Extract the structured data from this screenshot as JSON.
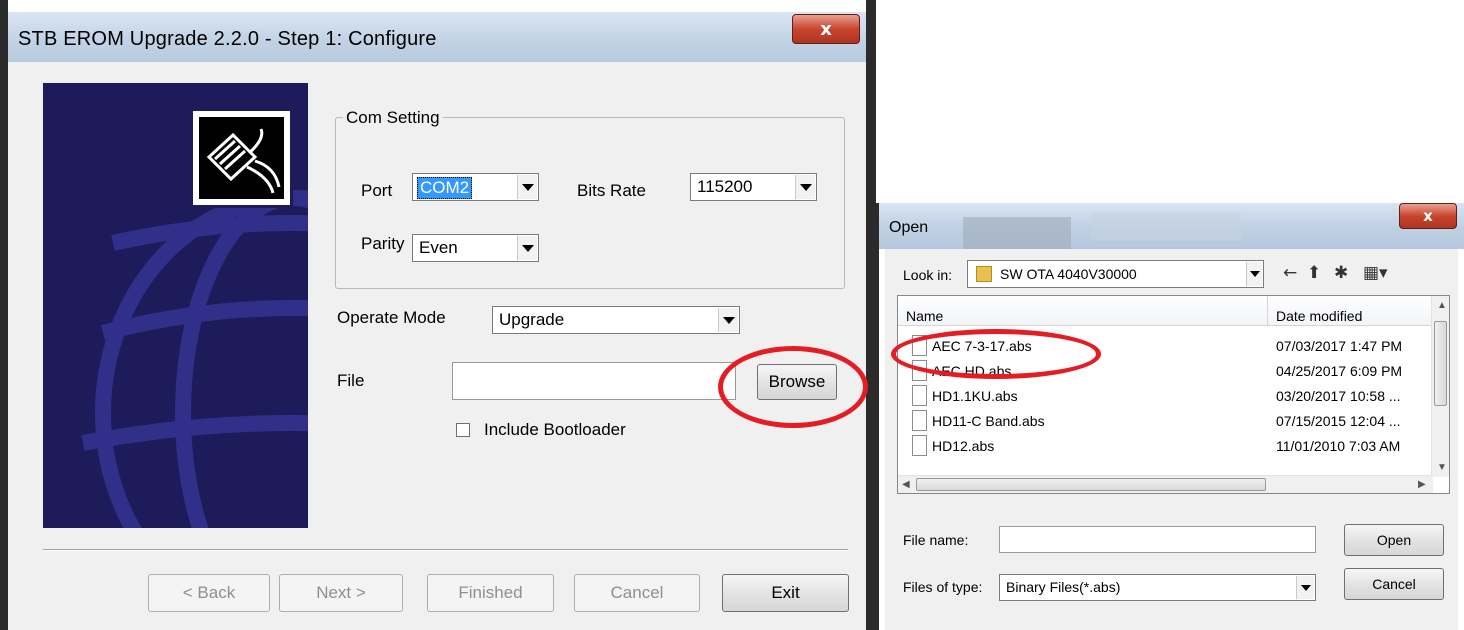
{
  "wizard": {
    "title": "STB EROM Upgrade 2.2.0  - Step 1: Configure",
    "close_glyph": "x",
    "com_setting": {
      "legend": "Com Setting",
      "port_label": "Port",
      "port_value": "COM2",
      "bits_rate_label": "Bits Rate",
      "bits_rate_value": "115200",
      "parity_label": "Parity",
      "parity_value": "Even"
    },
    "operate_mode_label": "Operate Mode",
    "operate_mode_value": "Upgrade",
    "file_label": "File",
    "file_value": "",
    "browse_label": "Browse",
    "include_bootloader_label": "Include Bootloader",
    "include_bootloader_checked": false,
    "buttons": {
      "back": "< Back",
      "next": "Next >",
      "finished": "Finished",
      "cancel": "Cancel",
      "exit": "Exit"
    }
  },
  "open_dialog": {
    "title": "Open",
    "close_glyph": "x",
    "look_in_label": "Look in:",
    "look_in_value": "SW OTA 4040V30000",
    "toolbar_icons": [
      "back-arrow-icon",
      "up-folder-icon",
      "new-folder-icon",
      "view-menu-icon"
    ],
    "columns": {
      "name": "Name",
      "date_modified": "Date modified"
    },
    "files": [
      {
        "name": "AEC 7-3-17.abs",
        "date": "07/03/2017 1:47 PM"
      },
      {
        "name": "AEC HD.abs",
        "date": "04/25/2017 6:09 PM"
      },
      {
        "name": "HD1.1KU.abs",
        "date": "03/20/2017 10:58 ..."
      },
      {
        "name": "HD11-C Band.abs",
        "date": "07/15/2015 12:04 ..."
      },
      {
        "name": "HD12.abs",
        "date": "11/01/2010 7:03 AM"
      }
    ],
    "file_name_label": "File name:",
    "file_name_value": "",
    "files_of_type_label": "Files of type:",
    "files_of_type_value": "Binary Files(*.abs)",
    "open_button": "Open",
    "cancel_button": "Cancel"
  },
  "annotation_color": "#e41d25"
}
